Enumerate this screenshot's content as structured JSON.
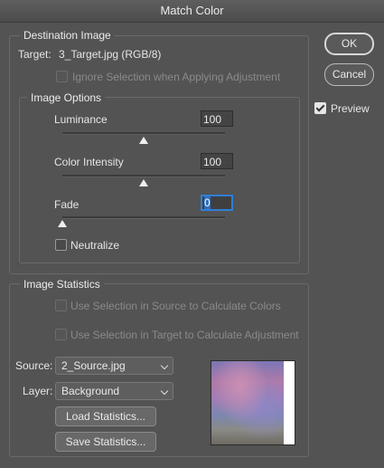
{
  "window": {
    "title": "Match Color"
  },
  "destination": {
    "legend": "Destination Image",
    "target_label": "Target:",
    "target_value": "3_Target.jpg (RGB/8)",
    "ignore_selection_label": "Ignore Selection when Applying Adjustment"
  },
  "options": {
    "legend": "Image Options",
    "luminance_label": "Luminance",
    "luminance_value": "100",
    "luminance_level": 0.5,
    "color_intensity_label": "Color Intensity",
    "color_intensity_value": "100",
    "color_intensity_level": 0.5,
    "fade_label": "Fade",
    "fade_value": "0",
    "fade_level": 0,
    "neutralize_label": "Neutralize"
  },
  "statistics": {
    "legend": "Image Statistics",
    "use_source_label": "Use Selection in Source to Calculate Colors",
    "use_target_label": "Use Selection in Target to Calculate Adjustment",
    "source_label": "Source:",
    "source_value": "2_Source.jpg",
    "layer_label": "Layer:",
    "layer_value": "Background",
    "load_label": "Load Statistics...",
    "save_label": "Save Statistics..."
  },
  "buttons": {
    "ok": "OK",
    "cancel": "Cancel"
  },
  "preview": {
    "label": "Preview",
    "checked": true
  }
}
